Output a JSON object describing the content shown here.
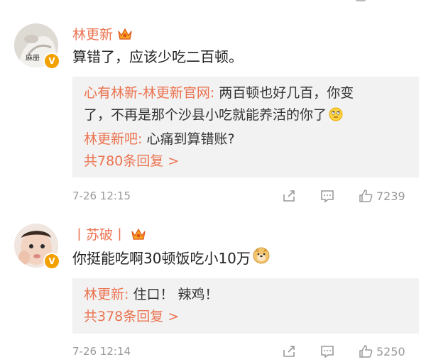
{
  "comments": [
    {
      "author": "林更新",
      "avatar_caption": "麻册",
      "text": "算错了，应该少吃二百顿。",
      "replies": [
        {
          "user": "心有林新-林更新官网:",
          "text": " 两百顿也好几百，你变"
        },
        {
          "user": "",
          "text": "了，不再是那个沙县小吃就能养活的你了"
        },
        {
          "user": "林更新吧:",
          "text": " 心痛到算错账?"
        }
      ],
      "more_replies": "共780条回复 >",
      "time": "7-26 12:15",
      "likes": "7239"
    },
    {
      "author": "丨苏破丨",
      "text": "你挺能吃啊30顿饭吃小10万",
      "replies": [
        {
          "user": "林更新:",
          "text": " 住口！ 辣鸡！"
        }
      ],
      "more_replies": "共378条回复 >",
      "time": "7-26 12:14",
      "likes": "5250"
    }
  ],
  "icons": [
    "crown-badge-icon",
    "verified-v-icon",
    "share-icon",
    "comment-icon",
    "like-icon",
    "emoji-roll-eyes-icon",
    "emoji-doge-icon"
  ],
  "colors": {
    "username": "#eb7350",
    "reply_bg": "#f2f2f2",
    "meta": "#999999",
    "badge": "#f2a100"
  }
}
